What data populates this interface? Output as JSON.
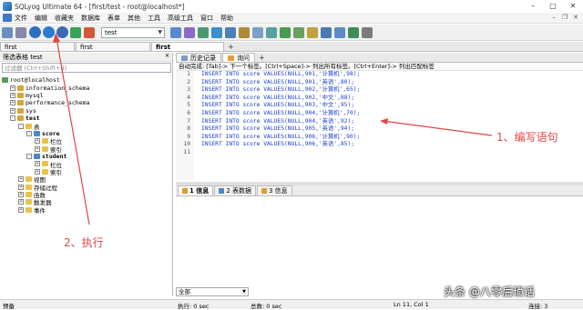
{
  "window": {
    "title": "SQLyog Ultimate 64 - [first/test - root@localhost*]",
    "controls": [
      "–",
      "□",
      "✕"
    ]
  },
  "menu": {
    "items": [
      "文件",
      "编辑",
      "收藏夹",
      "数据库",
      "表单",
      "其他",
      "工具",
      "高级工具",
      "窗口",
      "帮助"
    ]
  },
  "toolbar": {
    "db_selected": "test"
  },
  "connection_tabs": [
    {
      "label": "first"
    },
    {
      "label": "first"
    },
    {
      "label": "first"
    }
  ],
  "add_tab_label": "+",
  "left_panel": {
    "title": "筛选表格 test",
    "filter_placeholder": "过滤器 (Ctrl+Shift+B)",
    "tree": [
      {
        "label": "root@localhost",
        "indent": 0,
        "icon": "srv",
        "exp": ""
      },
      {
        "label": "information_schema",
        "indent": 1,
        "icon": "db",
        "exp": "+"
      },
      {
        "label": "mysql",
        "indent": 1,
        "icon": "db",
        "exp": "+"
      },
      {
        "label": "performance_schema",
        "indent": 1,
        "icon": "db",
        "exp": "+"
      },
      {
        "label": "sys",
        "indent": 1,
        "icon": "db",
        "exp": "+"
      },
      {
        "label": "test",
        "indent": 1,
        "icon": "db",
        "exp": "-"
      },
      {
        "label": "表",
        "indent": 2,
        "icon": "fold",
        "exp": "-"
      },
      {
        "label": "score",
        "indent": 3,
        "icon": "tbl",
        "exp": "-"
      },
      {
        "label": "栏位",
        "indent": 4,
        "icon": "fold",
        "exp": "+"
      },
      {
        "label": "索引",
        "indent": 4,
        "icon": "fold",
        "exp": "+"
      },
      {
        "label": "student",
        "indent": 3,
        "icon": "tbl",
        "exp": "-"
      },
      {
        "label": "栏位",
        "indent": 4,
        "icon": "fold",
        "exp": "+"
      },
      {
        "label": "索引",
        "indent": 4,
        "icon": "fold",
        "exp": "+"
      },
      {
        "label": "视图",
        "indent": 2,
        "icon": "fold",
        "exp": "+"
      },
      {
        "label": "存储过程",
        "indent": 2,
        "icon": "fold",
        "exp": "+"
      },
      {
        "label": "函数",
        "indent": 2,
        "icon": "fold",
        "exp": "+"
      },
      {
        "label": "触发器",
        "indent": 2,
        "icon": "fold",
        "exp": "+"
      },
      {
        "label": "事件",
        "indent": 2,
        "icon": "fold",
        "exp": "+"
      }
    ]
  },
  "query_tabs": [
    {
      "label": "历史记录"
    },
    {
      "label": "询问"
    }
  ],
  "query_add_label": "+",
  "hint_bar": "自动完成: [Tab]-> 下一个标签。[Ctrl+Space]-> 列出所有标签。[Ctrl+Enter]-> 列出匹配标签",
  "editor_lines": [
    {
      "n": "1",
      "text": "INSERT INTO score VALUES(NULL,901,'计算机',98);"
    },
    {
      "n": "2",
      "text": "INSERT INTO score VALUES(NULL,901,'英语',80);"
    },
    {
      "n": "3",
      "text": "INSERT INTO score VALUES(NULL,902,'计算机',65);"
    },
    {
      "n": "4",
      "text": "INSERT INTO score VALUES(NULL,902,'中文',88);"
    },
    {
      "n": "5",
      "text": "INSERT INTO score VALUES(NULL,903,'中文',95);"
    },
    {
      "n": "6",
      "text": "INSERT INTO score VALUES(NULL,904,'计算机',70);"
    },
    {
      "n": "7",
      "text": "INSERT INTO score VALUES(NULL,904,'英语',92);"
    },
    {
      "n": "8",
      "text": "INSERT INTO score VALUES(NULL,905,'英语',94);"
    },
    {
      "n": "9",
      "text": "INSERT INTO score VALUES(NULL,906,'计算机',90);"
    },
    {
      "n": "10",
      "text": "INSERT INTO score VALUES(NULL,906,'英语',85);"
    },
    {
      "n": "11",
      "text": ""
    }
  ],
  "result_tabs": [
    {
      "label": "1 信息"
    },
    {
      "label": "2 表数据"
    },
    {
      "label": "3 信息"
    }
  ],
  "bottom_select": "全部",
  "status": {
    "left": "预备",
    "exec": "执行: 0 sec",
    "total": "总数: 0 sec",
    "pos": "Ln 11, Col 1",
    "conn": "连接: 3"
  },
  "annotations": {
    "write_stmt": "1、编写语句",
    "execute": "2、执行",
    "color": "#e34646"
  },
  "watermark": "头条 @八零后琐话"
}
